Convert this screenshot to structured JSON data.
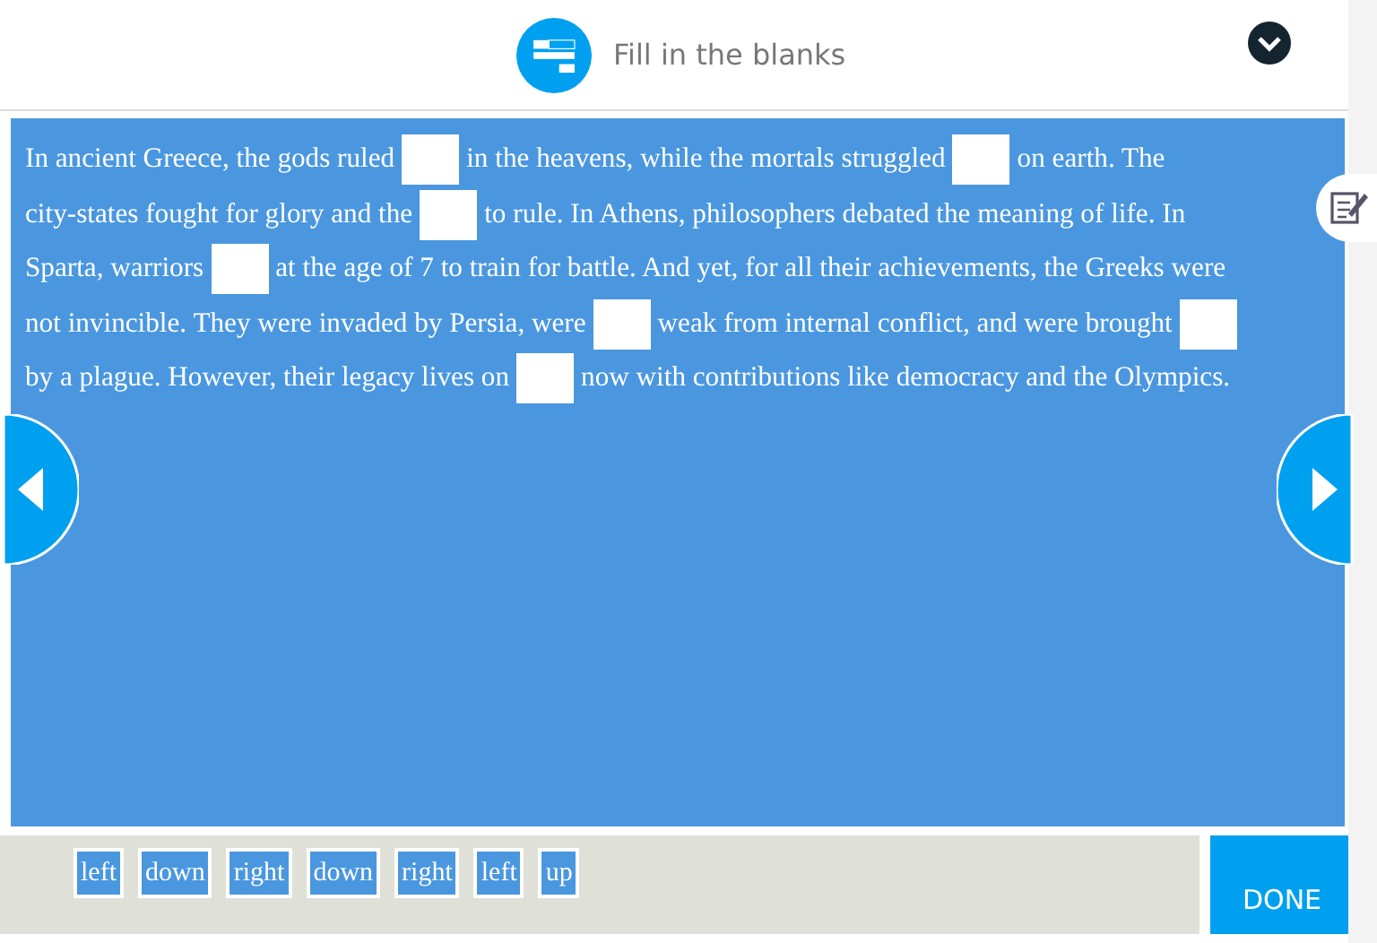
{
  "header": {
    "title": "Fill in the blanks"
  },
  "passage": [
    [
      {
        "kind": "text",
        "text": "In ancient Greece, the gods ruled"
      },
      {
        "kind": "blank"
      },
      {
        "kind": "text",
        "text": "in the heavens, while the mortals struggled"
      },
      {
        "kind": "blank"
      },
      {
        "kind": "text",
        "text": "on earth. The"
      }
    ],
    [
      {
        "kind": "text",
        "text": "city-states fought for glory and the"
      },
      {
        "kind": "blank"
      },
      {
        "kind": "text",
        "text": "to rule. In Athens, philosophers debated the meaning of life. In"
      }
    ],
    [
      {
        "kind": "text",
        "text": "Sparta, warriors"
      },
      {
        "kind": "blank"
      },
      {
        "kind": "text",
        "text": "at the age of 7 to train for battle. And yet, for all their achievements, the Greeks were"
      }
    ],
    [
      {
        "kind": "text",
        "text": "not invincible. They were invaded by Persia, were"
      },
      {
        "kind": "blank"
      },
      {
        "kind": "text",
        "text": "weak from internal conflict, and were brought"
      },
      {
        "kind": "blank"
      }
    ],
    [
      {
        "kind": "text",
        "text": "by a plague. However, their legacy lives on"
      },
      {
        "kind": "blank"
      },
      {
        "kind": "text",
        "text": "now with contributions like democracy and the Olympics."
      }
    ]
  ],
  "word_bank": [
    "left",
    "down",
    "right",
    "down",
    "right",
    "left",
    "up"
  ],
  "done_button": "DONE"
}
